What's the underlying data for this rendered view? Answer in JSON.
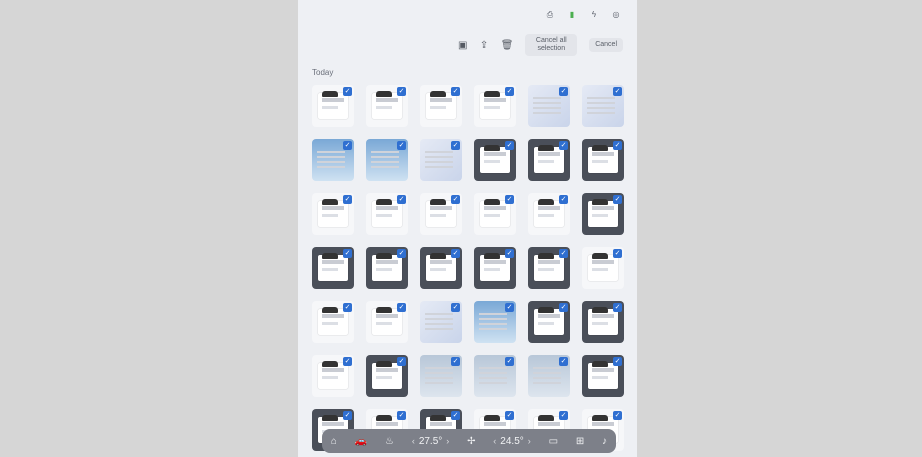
{
  "status_icons": [
    "printer-icon",
    "battery-icon",
    "signal-icon",
    "wifi-icon"
  ],
  "toolbar": {
    "icons": [
      "move-to-folder-icon",
      "share-icon",
      "trash-icon"
    ],
    "cancel_all_label": "Cancel all selection",
    "cancel_label": "Cancel"
  },
  "section": {
    "title": "Today"
  },
  "thumbs": [
    "light",
    "light",
    "light",
    "light",
    "soft",
    "soft",
    "sky",
    "sky",
    "soft",
    "dark",
    "dark",
    "dark",
    "light",
    "light",
    "light",
    "light",
    "light",
    "dark",
    "dark",
    "dark",
    "dark",
    "dark",
    "dark",
    "light",
    "light",
    "light",
    "soft",
    "sky",
    "dark",
    "dark",
    "light",
    "dark",
    "misty",
    "misty",
    "misty",
    "dark",
    "dark",
    "light",
    "dark",
    "light",
    "light",
    "light"
  ],
  "dock": {
    "left_temp": "27.5°",
    "right_temp": "24.5°"
  }
}
